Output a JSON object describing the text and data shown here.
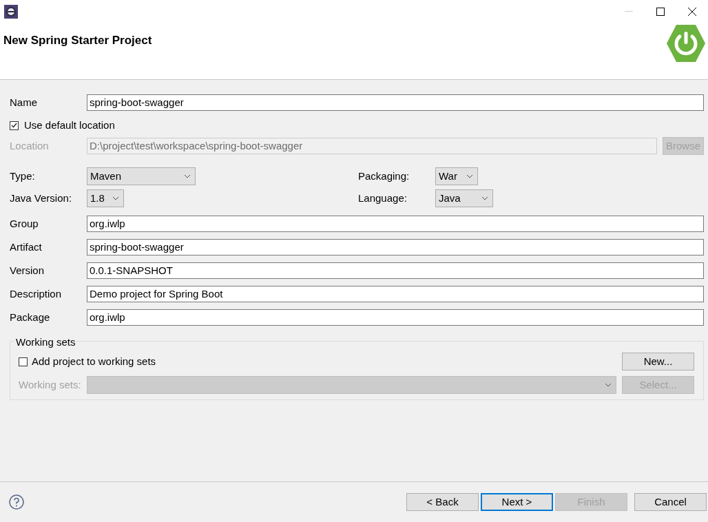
{
  "window": {
    "title": "New Spring Starter Project"
  },
  "name_field": {
    "label": "Name",
    "value": "spring-boot-swagger"
  },
  "default_location": {
    "label": "Use default location",
    "checked": true
  },
  "location": {
    "label": "Location",
    "value": "D:\\project\\test\\workspace\\spring-boot-swagger",
    "disabled": true
  },
  "browse_button": {
    "label": "Browse",
    "disabled": true
  },
  "selects_left": [
    {
      "label": "Type:",
      "value": "Maven"
    },
    {
      "label": "Java Version:",
      "value": "1.8"
    }
  ],
  "selects_right": [
    {
      "label": "Packaging:",
      "value": "War"
    },
    {
      "label": "Language:",
      "value": "Java"
    }
  ],
  "fields": [
    {
      "label": "Group",
      "value": "org.iwlp"
    },
    {
      "label": "Artifact",
      "value": "spring-boot-swagger"
    },
    {
      "label": "Version",
      "value": "0.0.1-SNAPSHOT"
    },
    {
      "label": "Description",
      "value": "Demo project for Spring Boot"
    },
    {
      "label": "Package",
      "value": "org.iwlp"
    }
  ],
  "working_sets": {
    "title": "Working sets",
    "add_checkbox": {
      "label": "Add project to working sets",
      "checked": false
    },
    "new_button": {
      "label": "New...",
      "disabled": false
    },
    "sets_label": "Working sets:",
    "sets_disabled": true,
    "select_button": {
      "label": "Select...",
      "disabled": true
    }
  },
  "buttons": [
    {
      "label": "< Back",
      "disabled": false,
      "focused": false
    },
    {
      "label": "Next >",
      "disabled": false,
      "focused": true
    },
    {
      "label": "Finish",
      "disabled": true,
      "focused": false
    },
    {
      "label": "Cancel",
      "disabled": false,
      "focused": false
    }
  ]
}
